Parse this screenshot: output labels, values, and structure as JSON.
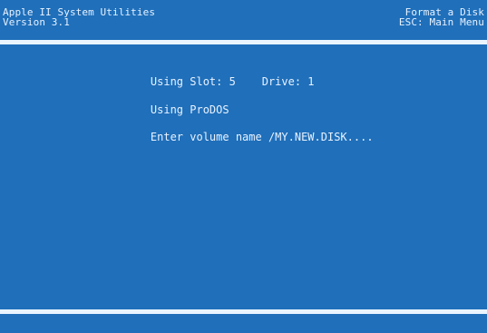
{
  "header": {
    "title": "Apple II System Utilities",
    "version": "Version 3.1",
    "screen_title": "Format a Disk",
    "escape_hint": "ESC: Main Menu"
  },
  "main": {
    "slot_label": "Using Slot: 5",
    "drive_label": "Drive: 1",
    "system_label": "Using ProDOS",
    "volume_prompt": "Enter volume name /MY.NEW.DISK...."
  },
  "colors": {
    "screen_background": "#1f6fba",
    "text": "#e8f2ff",
    "rule": "#eaf4ff"
  }
}
